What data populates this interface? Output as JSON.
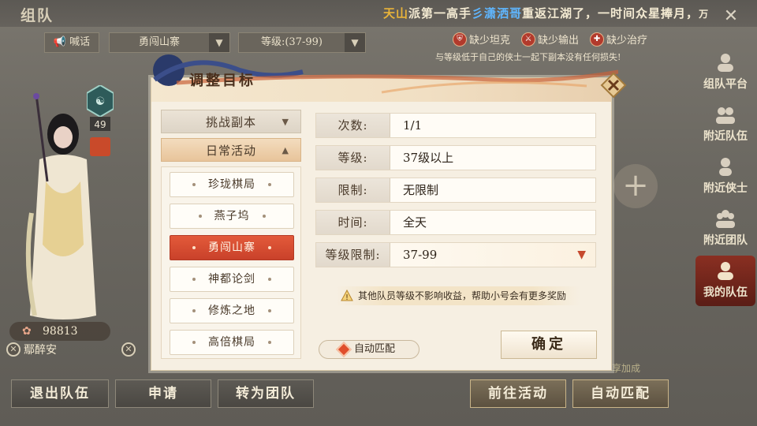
{
  "screen": {
    "title": "组队",
    "marquee": {
      "sect": "天山",
      "text_a": "派第一高手",
      "player": "彡潇洒哥",
      "text_b": "重返江湖了，一时间众星捧月，",
      "tail": "万"
    }
  },
  "filters": {
    "shout_label": "喊话",
    "dungeon_value": "勇闯山寨",
    "level_value": "等级:(37-99)"
  },
  "missing_roles": [
    {
      "label": "缺少坦克",
      "icon": "shield-icon"
    },
    {
      "label": "缺少输出",
      "icon": "sword-icon"
    },
    {
      "label": "缺少治疗",
      "icon": "heal-icon"
    }
  ],
  "notice": "与等级低于自己的侠士一起下副本没有任何损失!",
  "player": {
    "level": "49",
    "score": "98813",
    "name": "鄢醉安"
  },
  "sidebar": [
    {
      "label": "组队平台",
      "icon": "team-platform-icon",
      "active": false
    },
    {
      "label": "附近队伍",
      "icon": "nearby-team-icon",
      "active": false
    },
    {
      "label": "附近侠士",
      "icon": "nearby-player-icon",
      "active": false
    },
    {
      "label": "附近团队",
      "icon": "nearby-group-icon",
      "active": false
    },
    {
      "label": "我的队伍",
      "icon": "my-team-icon",
      "active": true
    }
  ],
  "bottom_buttons": {
    "leave": "退出队伍",
    "apply": "申请",
    "convert": "转为团队",
    "goto": "前往活动",
    "auto_match": "自动匹配",
    "partial_text": "享加成"
  },
  "dialog": {
    "title": "调整目标",
    "categories": {
      "challenge": "挑战副本",
      "daily": "日常活动"
    },
    "sub_items": [
      "珍珑棋局",
      "燕子坞",
      "勇闯山寨",
      "神都论剑",
      "修炼之地",
      "高倍棋局"
    ],
    "selected_index": 2,
    "rows": [
      {
        "label": "次数:",
        "value": "1/1"
      },
      {
        "label": "等级:",
        "value": "37级以上"
      },
      {
        "label": "限制:",
        "value": "无限制"
      },
      {
        "label": "时间:",
        "value": "全天"
      },
      {
        "label": "等级限制:",
        "value": "37-99"
      }
    ],
    "hint": "其他队员等级不影响收益，帮助小号会有更多奖励",
    "auto_match_label": "自动匹配",
    "auto_match_checked": true,
    "confirm_label": "确定"
  },
  "colors": {
    "accent_red": "#c9412a",
    "gold": "#e8b33a",
    "blue": "#5fb6ff",
    "panel_bg": "#f6efe2"
  }
}
